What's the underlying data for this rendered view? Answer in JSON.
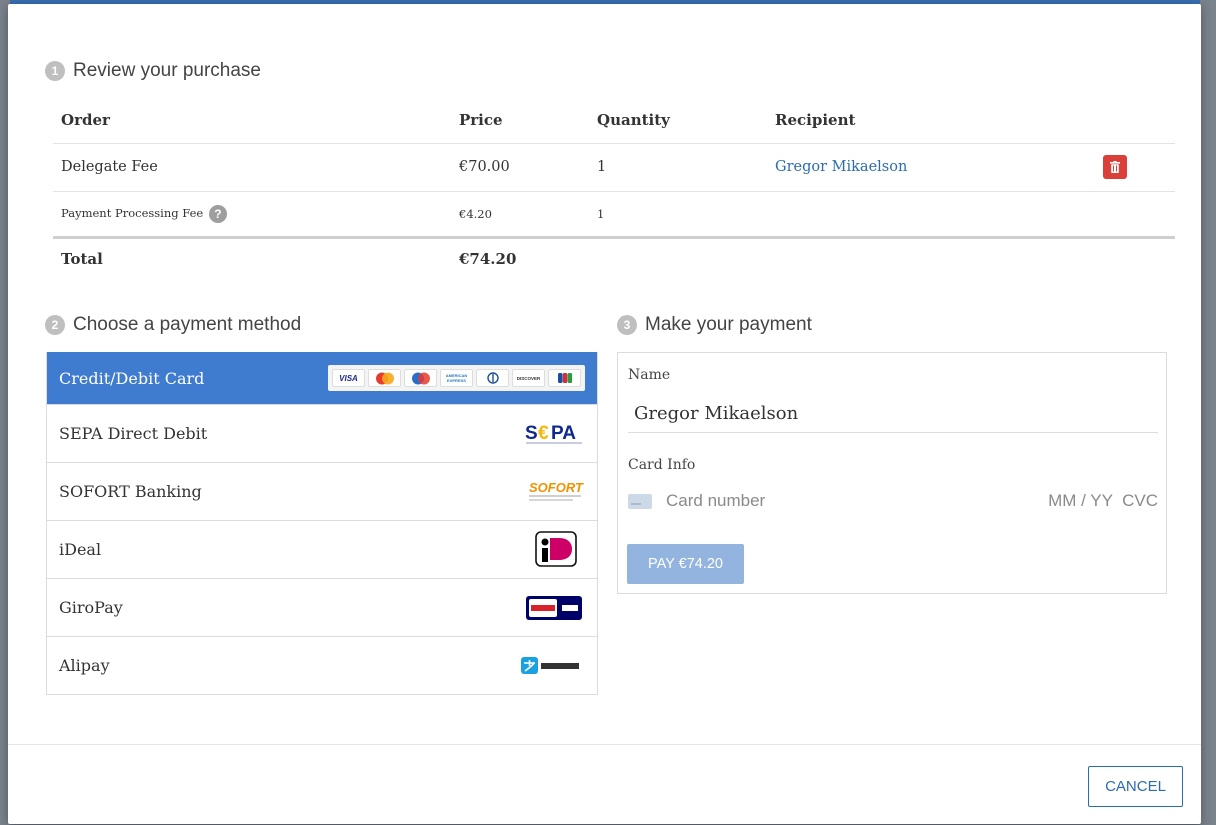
{
  "review": {
    "step": "1",
    "title": "Review your purchase",
    "headers": {
      "order": "Order",
      "price": "Price",
      "quantity": "Quantity",
      "recipient": "Recipient"
    },
    "rows": [
      {
        "order": "Delegate Fee",
        "price": "€70.00",
        "quantity": "1",
        "recipient": "Gregor Mikaelson"
      },
      {
        "order": "Payment Processing Fee",
        "price": "€4.20",
        "quantity": "1",
        "recipient": ""
      }
    ],
    "help_glyph": "?",
    "total_label": "Total",
    "total_value": "€74.20"
  },
  "methods": {
    "step": "2",
    "title": "Choose a payment method",
    "items": [
      {
        "label": "Credit/Debit Card",
        "active": true
      },
      {
        "label": "SEPA Direct Debit",
        "logo": "sepa-logo"
      },
      {
        "label": "SOFORT Banking",
        "logo": "sofort-logo"
      },
      {
        "label": "iDeal",
        "logo": "ideal-logo"
      },
      {
        "label": "GiroPay",
        "logo": "giropay-logo"
      },
      {
        "label": "Alipay",
        "logo": "alipay-logo"
      }
    ],
    "card_brands": [
      "VISA",
      "Mastercard",
      "Maestro",
      "AMERICAN EXPRESS",
      "Diners Club",
      "DISCOVER",
      "JCB"
    ]
  },
  "payment": {
    "step": "3",
    "title": "Make your payment",
    "name_label": "Name",
    "name_value": "Gregor Mikaelson",
    "card_label": "Card Info",
    "card_number_placeholder": "Card number",
    "expiry_cvc_placeholder": "MM / YY  CVC",
    "pay_label": "PAY €74.20"
  },
  "footer": {
    "cancel_label": "CANCEL"
  },
  "colors": {
    "accent": "#3f7bcf",
    "link": "#2a6cae",
    "danger": "#d9403a",
    "pay_disabled": "#94b4e0"
  }
}
